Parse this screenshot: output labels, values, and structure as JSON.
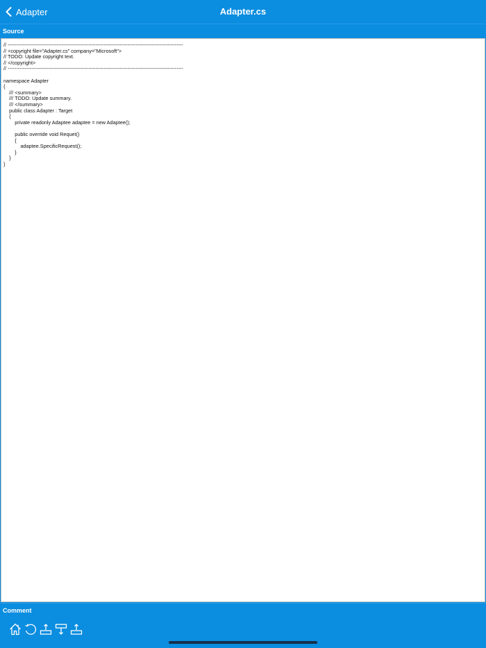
{
  "navbar": {
    "back_label": "Adapter",
    "title": "Adapter.cs"
  },
  "sections": {
    "source_label": "Source",
    "comment_label": "Comment"
  },
  "source_code": "// --------------------------------------------------------------------------------------------------------\n// <copyright file=\"Adapter.cs\" company=\"Microsoft\">\n// TODO: Update copyright text.\n// </copyright>\n// --------------------------------------------------------------------------------------------------------\n\nnamespace Adapter\n{\n    /// <summary>\n    /// TODO: Update summary.\n    /// </summary>\n    public class Adapter : Target\n    {\n        private readonly Adaptee adaptee = new Adaptee();\n\n        public override void Requet()\n        {\n            adaptee.SpecificRequest();\n        }\n    }\n}",
  "toolbar": {
    "buttons": [
      "home-icon",
      "reload-icon",
      "upload-icon",
      "download-icon",
      "share-icon"
    ]
  },
  "colors": {
    "accent": "#0b8de0",
    "text_on_accent": "#ffffff",
    "code_background": "#ffffff"
  }
}
